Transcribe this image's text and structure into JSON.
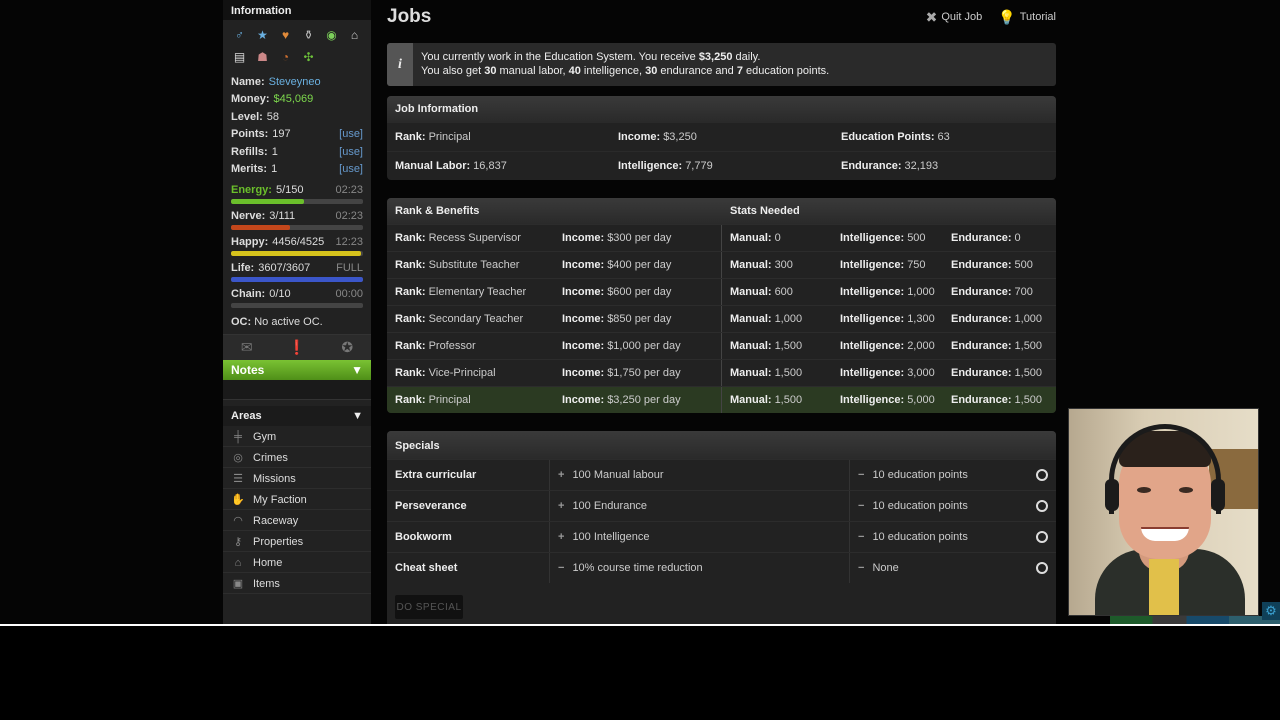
{
  "sidebar": {
    "info_title": "Information",
    "icons": [
      {
        "name": "male-icon",
        "glyph": "♂",
        "color": "#6ab0e0"
      },
      {
        "name": "star-icon",
        "glyph": "★",
        "color": "#6ab0e0"
      },
      {
        "name": "heart-icon",
        "glyph": "♥",
        "color": "#e08a3a"
      },
      {
        "name": "trophy-icon",
        "glyph": "⚱",
        "color": "#bbb"
      },
      {
        "name": "globe-icon",
        "glyph": "◉",
        "color": "#7ccf5a"
      },
      {
        "name": "bank-icon",
        "glyph": "⌂",
        "color": "#ccc"
      },
      {
        "name": "mailbox-icon",
        "glyph": "▤",
        "color": "#ddd"
      },
      {
        "name": "hat-icon",
        "glyph": "☗",
        "color": "#c88"
      },
      {
        "name": "speedometer-icon",
        "glyph": "◔",
        "color": "#d07030"
      },
      {
        "name": "plant-icon",
        "glyph": "✣",
        "color": "#6cbf3a"
      }
    ],
    "name_label": "Name:",
    "name_value": "Steveyneo",
    "money_label": "Money:",
    "money_value": "$45,069",
    "level_label": "Level:",
    "level_value": "58",
    "points_label": "Points:",
    "points_value": "197",
    "refills_label": "Refills:",
    "refills_value": "1",
    "merits_label": "Merits:",
    "merits_value": "1",
    "use_label": "[use]",
    "bars": [
      {
        "key": "energy",
        "label": "Energy:",
        "value": "5/150",
        "time": "02:23",
        "fraction": 0.55,
        "color": "#6bbf2b"
      },
      {
        "key": "nerve",
        "label": "Nerve:",
        "value": "3/111",
        "time": "02:23",
        "fraction": 0.45,
        "color": "#c4471b"
      },
      {
        "key": "happy",
        "label": "Happy:",
        "value": "4456/4525",
        "time": "12:23",
        "fraction": 0.985,
        "color": "#d6c21c"
      },
      {
        "key": "life",
        "label": "Life:",
        "value": "3607/3607",
        "time": "FULL",
        "fraction": 1.0,
        "color": "#3b56c9"
      },
      {
        "key": "chain",
        "label": "Chain:",
        "value": "0/10",
        "time": "00:00",
        "fraction": 0.0,
        "color": "#888"
      }
    ],
    "oc_label": "OC:",
    "oc_value": "No active OC.",
    "notes_label": "Notes",
    "areas_title": "Areas",
    "areas": [
      {
        "label": "Gym",
        "icon": "dumbbell-icon",
        "glyph": "╪"
      },
      {
        "label": "Crimes",
        "icon": "fingerprint-icon",
        "glyph": "◎"
      },
      {
        "label": "Missions",
        "icon": "missions-icon",
        "glyph": "☰"
      },
      {
        "label": "My Faction",
        "icon": "faction-icon",
        "glyph": "✋"
      },
      {
        "label": "Raceway",
        "icon": "raceway-icon",
        "glyph": "◠"
      },
      {
        "label": "Properties",
        "icon": "key-icon",
        "glyph": "⚷"
      },
      {
        "label": "Home",
        "icon": "home-icon",
        "glyph": "⌂"
      },
      {
        "label": "Items",
        "icon": "box-icon",
        "glyph": "▣"
      }
    ]
  },
  "main": {
    "title": "Jobs",
    "quit_label": "Quit Job",
    "tutorial_label": "Tutorial",
    "message_line1_prefix": "You currently work in the Education System. You receive ",
    "message_line1_amount": "$3,250",
    "message_line1_suffix": " daily.",
    "message_line2_a": "You also get ",
    "message_line2_b": "30",
    "message_line2_c": " manual labor, ",
    "message_line2_d": "40",
    "message_line2_e": " intelligence, ",
    "message_line2_f": "30",
    "message_line2_g": " endurance and ",
    "message_line2_h": "7",
    "message_line2_i": " education points.",
    "job_info_title": "Job Information",
    "job_info": [
      {
        "label": "Rank:",
        "value": "Principal"
      },
      {
        "label": "Income:",
        "value": "$3,250"
      },
      {
        "label": "Education Points:",
        "value": "63"
      },
      {
        "label": "Manual Labor:",
        "value": "16,837"
      },
      {
        "label": "Intelligence:",
        "value": "7,779"
      },
      {
        "label": "Endurance:",
        "value": "32,193"
      }
    ],
    "rank_title": "Rank & Benefits",
    "stats_title": "Stats Needed",
    "rank_label": "Rank:",
    "income_label": "Income:",
    "manual_label": "Manual:",
    "intel_label": "Intelligence:",
    "endur_label": "Endurance:",
    "ranks": [
      {
        "rank": "Recess Supervisor",
        "income": "$300 per day",
        "manual": "0",
        "intel": "500",
        "endur": "0"
      },
      {
        "rank": "Substitute Teacher",
        "income": "$400 per day",
        "manual": "300",
        "intel": "750",
        "endur": "500"
      },
      {
        "rank": "Elementary Teacher",
        "income": "$600 per day",
        "manual": "600",
        "intel": "1,000",
        "endur": "700"
      },
      {
        "rank": "Secondary Teacher",
        "income": "$850 per day",
        "manual": "1,000",
        "intel": "1,300",
        "endur": "1,000"
      },
      {
        "rank": "Professor",
        "income": "$1,000 per day",
        "manual": "1,500",
        "intel": "2,000",
        "endur": "1,500"
      },
      {
        "rank": "Vice-Principal",
        "income": "$1,750 per day",
        "manual": "1,500",
        "intel": "3,000",
        "endur": "1,500"
      },
      {
        "rank": "Principal",
        "income": "$3,250 per day",
        "manual": "1,500",
        "intel": "5,000",
        "endur": "1,500"
      }
    ],
    "specials_title": "Specials",
    "specials": [
      {
        "name": "Extra curricular",
        "benefit_sign": "+",
        "benefit": "100 Manual labour",
        "cost_sign": "−",
        "cost": "10 education points"
      },
      {
        "name": "Perseverance",
        "benefit_sign": "+",
        "benefit": "100 Endurance",
        "cost_sign": "−",
        "cost": "10 education points"
      },
      {
        "name": "Bookworm",
        "benefit_sign": "+",
        "benefit": "100 Intelligence",
        "cost_sign": "−",
        "cost": "10 education points"
      },
      {
        "name": "Cheat sheet",
        "benefit_sign": "−",
        "benefit": "10% course time reduction",
        "cost_sign": "−",
        "cost": "None"
      }
    ],
    "do_special_label": "DO SPECIAL"
  },
  "colors": {
    "accent_green": "#6bbf2b",
    "link_blue": "#6ab0e0",
    "active_row": "#2b3a22"
  }
}
